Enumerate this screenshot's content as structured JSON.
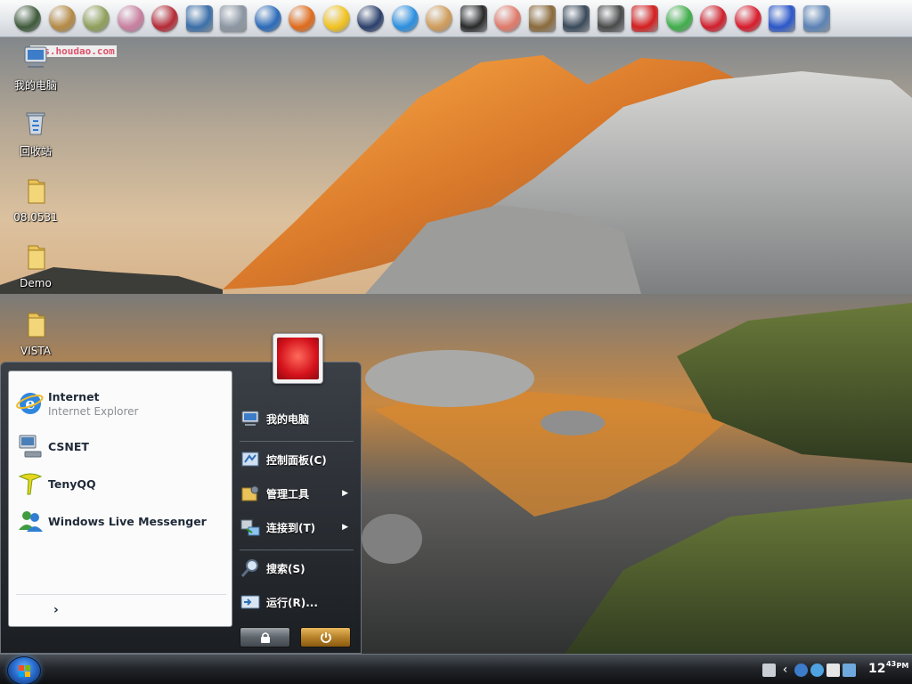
{
  "watermark": {
    "url_text": "bbs.houdao.com"
  },
  "quick_launch": [
    {
      "icon": "app-globe-icon",
      "color": "#3e5a3a",
      "shape": "round"
    },
    {
      "icon": "cartoon-face-icon",
      "color": "#b58a44",
      "shape": "round"
    },
    {
      "icon": "cartoon-face-2-icon",
      "color": "#8fa05a",
      "shape": "round"
    },
    {
      "icon": "clown-face-icon",
      "color": "#c97fa0",
      "shape": "round"
    },
    {
      "icon": "pirate-face-icon",
      "color": "#b52a36",
      "shape": "round"
    },
    {
      "icon": "monitor-icon",
      "color": "#3b6fa8",
      "shape": "square"
    },
    {
      "icon": "network-computer-icon",
      "color": "#8c97a3",
      "shape": "square"
    },
    {
      "icon": "maxthon-icon",
      "color": "#2a6ab9",
      "shape": "round"
    },
    {
      "icon": "firefox-icon",
      "color": "#e06b1b",
      "shape": "round"
    },
    {
      "icon": "qq-penguin-icon",
      "color": "#f2c21e",
      "shape": "round"
    },
    {
      "icon": "penguin-icon",
      "color": "#2a3f6b",
      "shape": "round"
    },
    {
      "icon": "bird-icon",
      "color": "#2b8fe0",
      "shape": "round"
    },
    {
      "icon": "rabbit-icon",
      "color": "#cf9c5a",
      "shape": "round"
    },
    {
      "icon": "foobar-icon",
      "color": "#2a2a2a",
      "shape": "square"
    },
    {
      "icon": "worm-icon",
      "color": "#e07a6a",
      "shape": "round"
    },
    {
      "icon": "bell-icon",
      "color": "#8b6b3b",
      "shape": "square"
    },
    {
      "icon": "game-character-icon",
      "color": "#3a4a5a",
      "shape": "square"
    },
    {
      "icon": "com-tool-icon",
      "color": "#4a4a4a",
      "shape": "square"
    },
    {
      "icon": "red-box-icon",
      "color": "#d41f1f",
      "shape": "square"
    },
    {
      "icon": "globe-ring-icon",
      "color": "#3fae4a",
      "shape": "round"
    },
    {
      "icon": "shield-icon",
      "color": "#d01f2c",
      "shape": "round"
    },
    {
      "icon": "red-x-icon",
      "color": "#d81b2b",
      "shape": "round"
    },
    {
      "icon": "google-icon",
      "color": "#2b57c9",
      "shape": "square"
    },
    {
      "icon": "device-icon",
      "color": "#5b83b5",
      "shape": "square"
    }
  ],
  "desktop_icons": [
    {
      "label": "我的电脑",
      "icon": "my-computer-icon"
    },
    {
      "label": "回收站",
      "icon": "recycle-bin-icon"
    },
    {
      "label": "08.0531",
      "icon": "folder-icon"
    },
    {
      "label": "Demo",
      "icon": "folder-icon"
    },
    {
      "label": "VISTA",
      "icon": "folder-icon"
    }
  ],
  "start_menu": {
    "pinned": [
      {
        "name": "Internet",
        "sub": "Internet Explorer",
        "icon": "internet-explorer-icon"
      },
      {
        "name": "CSNET",
        "sub": "",
        "icon": "network-computer-icon"
      },
      {
        "name": "TenyQQ",
        "sub": "",
        "icon": "tenyqq-icon"
      },
      {
        "name": "Windows Live Messenger",
        "sub": "",
        "icon": "messenger-icon"
      }
    ],
    "all_programs_glyph": "›",
    "right_items": [
      {
        "label": "我的电脑",
        "icon": "my-computer-icon",
        "arrow": ""
      },
      {
        "label": "控制面板(C)",
        "icon": "control-panel-icon",
        "arrow": ""
      },
      {
        "label": "管理工具",
        "icon": "admin-tools-icon",
        "arrow": "▶"
      },
      {
        "label": "连接到(T)",
        "icon": "connect-to-icon",
        "arrow": "▶"
      },
      {
        "label": "搜索(S)",
        "icon": "search-icon",
        "arrow": ""
      },
      {
        "label": "运行(R)...",
        "icon": "run-icon",
        "arrow": ""
      }
    ]
  },
  "taskbar": {
    "clock_hour": "12",
    "clock_minute": "43",
    "clock_ampm": "PM",
    "tray_icons": [
      "keyboard-icon",
      "chevron-left-icon",
      "antivirus-icon",
      "network-icon",
      "language-icon",
      "window-icon"
    ]
  }
}
